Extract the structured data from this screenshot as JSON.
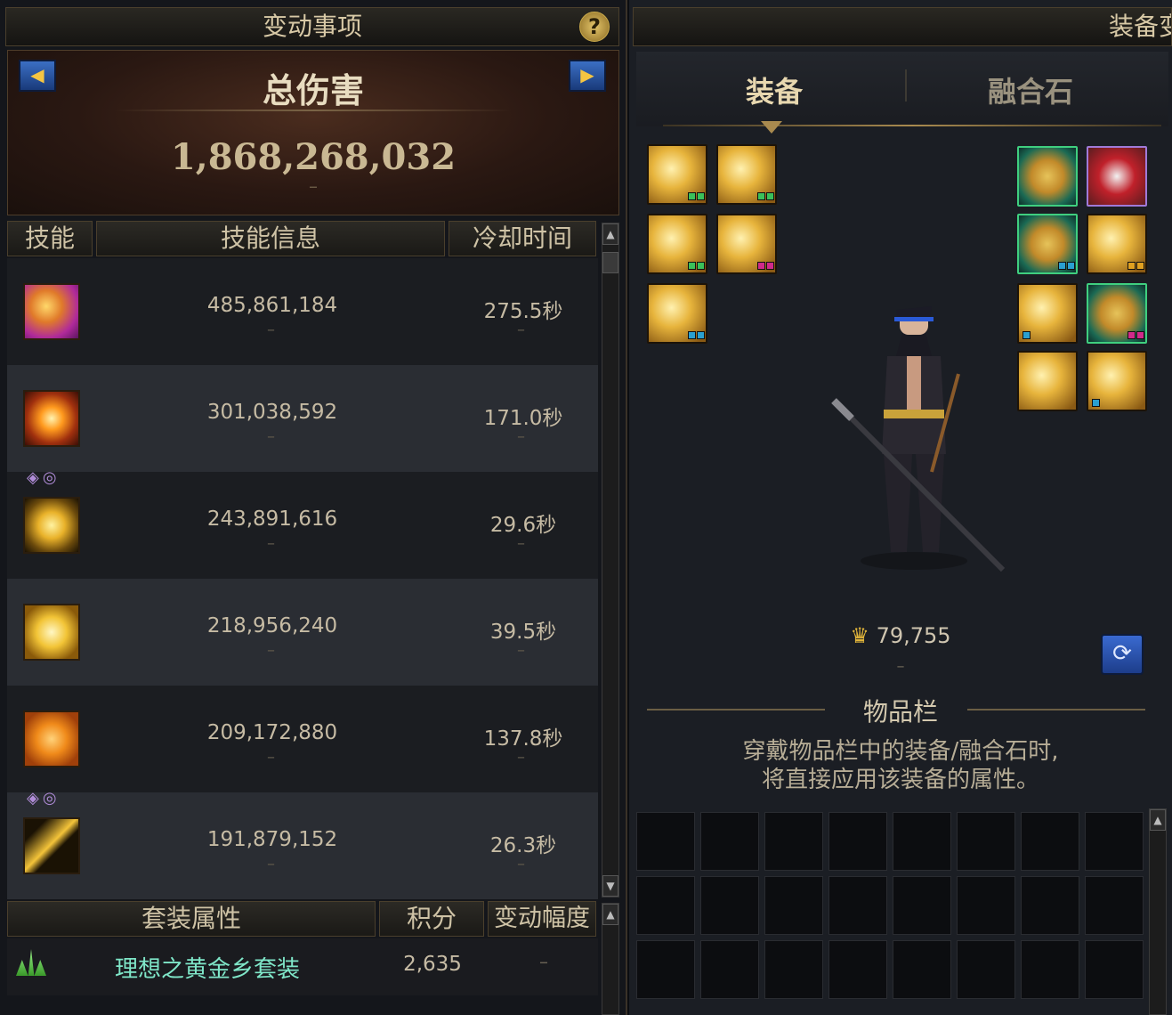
{
  "left_panel": {
    "title": "变动事项",
    "help_label": "?",
    "banner": {
      "prev_label": "◀",
      "next_label": "▶",
      "title": "总伤害",
      "value": "1,868,268,032",
      "dash": "–"
    },
    "columns": {
      "skill": "技能",
      "info": "技能信息",
      "cooldown": "冷却时间"
    },
    "skills": [
      {
        "icon": "magenta-slash-skill-icon",
        "damage": "485,861,184",
        "cooldown": "275.5秒",
        "dash": "–"
      },
      {
        "icon": "burst-skill-icon",
        "damage": "301,038,592",
        "cooldown": "171.0秒",
        "dash": "–"
      },
      {
        "icon": "gold-ring-skill-icon",
        "damage": "243,891,616",
        "cooldown": "29.6秒",
        "dash": "–",
        "tags": "◈◎"
      },
      {
        "icon": "wu-slash-skill-icon",
        "damage": "218,956,240",
        "cooldown": "39.5秒",
        "dash": "–"
      },
      {
        "icon": "orange-vortex-skill-icon",
        "damage": "209,172,880",
        "cooldown": "137.8秒",
        "dash": "–"
      },
      {
        "icon": "lightning-skill-icon",
        "damage": "191,879,152",
        "cooldown": "26.3秒",
        "dash": "–",
        "tags": "◈◎"
      }
    ],
    "set_columns": {
      "set": "套装属性",
      "score": "积分",
      "change": "变动幅度"
    },
    "set_row": {
      "name": "理想之黄金乡套装",
      "score": "2,635",
      "change": "–"
    }
  },
  "right_panel": {
    "title": "装备变",
    "tabs": [
      "装备",
      "融合石"
    ],
    "active_tab": 0,
    "score_value": "79,755",
    "score_dash": "–",
    "inventory_title": "物品栏",
    "inventory_desc": [
      "穿戴物品栏中的装备/融合石时,",
      "将直接应用该装备的属性。"
    ]
  },
  "colors": {
    "accent_gold": "#c9a94b",
    "set_name_color": "#7fe6c8",
    "blue_button": "#2a5ab0"
  }
}
